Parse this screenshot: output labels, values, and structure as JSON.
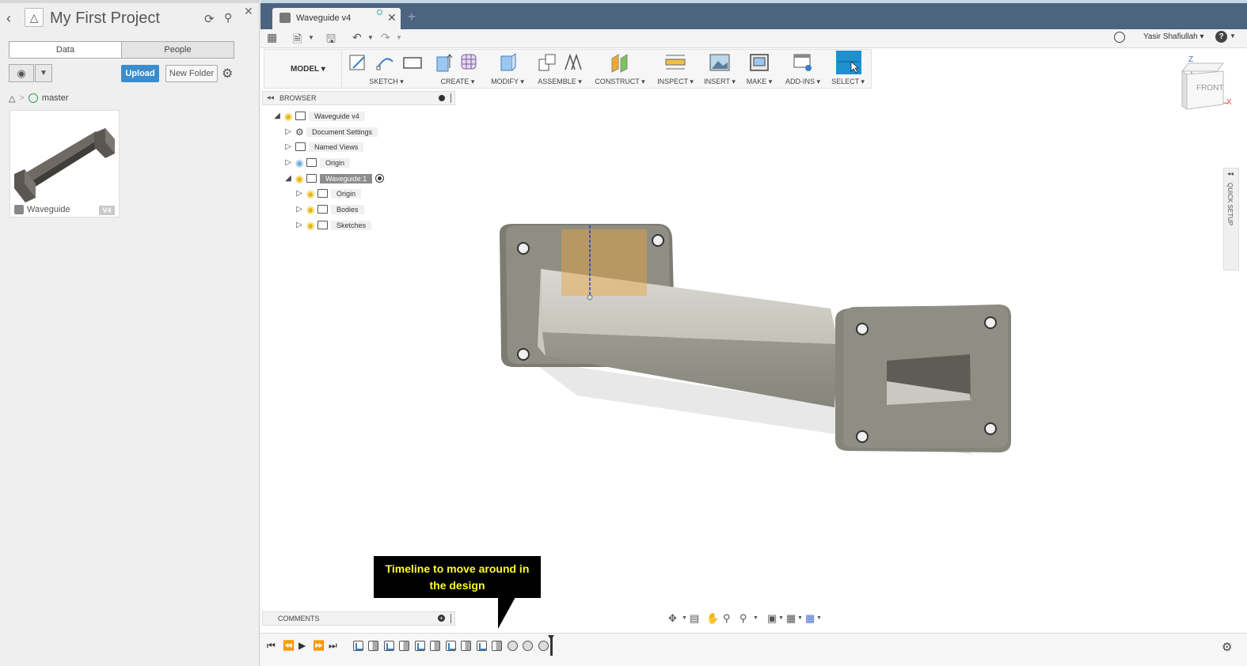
{
  "data_panel": {
    "project_title": "My First Project",
    "tabs": [
      "Data",
      "People"
    ],
    "upload_label": "Upload",
    "new_folder_label": "New Folder",
    "breadcrumb_branch": "master",
    "card": {
      "name": "Waveguide",
      "version": "V4"
    }
  },
  "document_tab": {
    "label": "Waveguide v4"
  },
  "quick_access": {
    "user": "Yasir Shafiullah ▾"
  },
  "toolbar": {
    "workspace": "MODEL ▾",
    "groups": [
      "SKETCH ▾",
      "CREATE ▾",
      "MODIFY ▾",
      "ASSEMBLE ▾",
      "CONSTRUCT ▾",
      "INSPECT ▾",
      "INSERT ▾",
      "MAKE ▾",
      "ADD-INS ▾",
      "SELECT ▾"
    ]
  },
  "browser": {
    "title": "BROWSER",
    "root": "Waveguide v4",
    "items": [
      "Document Settings",
      "Named Views",
      "Origin",
      "Waveguide:1"
    ],
    "component_items": [
      "Origin",
      "Bodies",
      "Sketches"
    ]
  },
  "viewcube": {
    "face": "FRONT",
    "axis_z": "Z",
    "axis_x": "X"
  },
  "quick_setup": "QUICK SETUP",
  "comments": {
    "title": "COMMENTS"
  },
  "callout": {
    "text_line1": "Timeline to move around in",
    "text_line2": "the design"
  },
  "colors": {
    "tabbar": "#4d6480",
    "accent": "#3d8dcc",
    "select_active": "#1e90d0",
    "callout_bg": "#000000",
    "callout_text": "#ffff2a"
  }
}
